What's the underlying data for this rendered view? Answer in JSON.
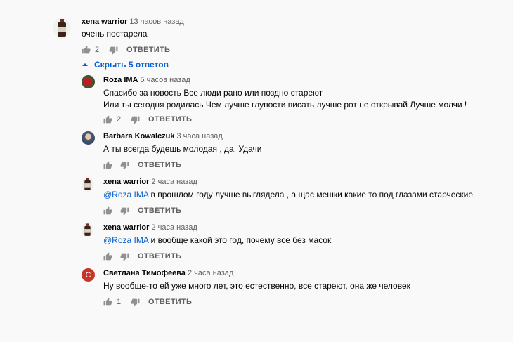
{
  "toggle_label": "Скрыть 5 ответов",
  "reply_label": "ОТВЕТИТЬ",
  "comments": [
    {
      "author": "xena warrior",
      "time": "13 часов назад",
      "lines": [
        "очень постарела"
      ],
      "likes": "2",
      "avatar": "bottle-avatar"
    },
    {
      "author": "Roza IMA",
      "time": "5 часов назад",
      "lines": [
        "Спасибо за новость Все люди рано или поздно стареют",
        "Или ты сегодня родилась Чем лучше глупости писать лучше рот не открывай Лучше молчи !"
      ],
      "likes": "2",
      "avatar": "rose-avatar"
    },
    {
      "author": "Barbara Kowalczuk",
      "time": "3 часа назад",
      "lines": [
        "А ты всегда будешь молодая , да. Удачи"
      ],
      "likes": "",
      "avatar": "person-avatar"
    },
    {
      "author": "xena warrior",
      "time": "2 часа назад",
      "mention": "@Roza IMA",
      "lines": [
        " в прошлом году лучше выглядела , а щас мешки какие то под глазами старческие"
      ],
      "likes": "",
      "avatar": "bottle-avatar"
    },
    {
      "author": "xena warrior",
      "time": "2 часа назад",
      "mention": "@Roza IMA",
      "lines": [
        " и вообще какой это год, почему все без масок"
      ],
      "likes": "",
      "avatar": "bottle-avatar"
    },
    {
      "author": "Светлана Тимофеева",
      "time": "2 часа назад",
      "lines": [
        "Ну вообще-то ей уже много лет, это естественно, все стареют, она же человек"
      ],
      "likes": "1",
      "avatar_letter": "С",
      "avatar": "letter-avatar"
    }
  ]
}
